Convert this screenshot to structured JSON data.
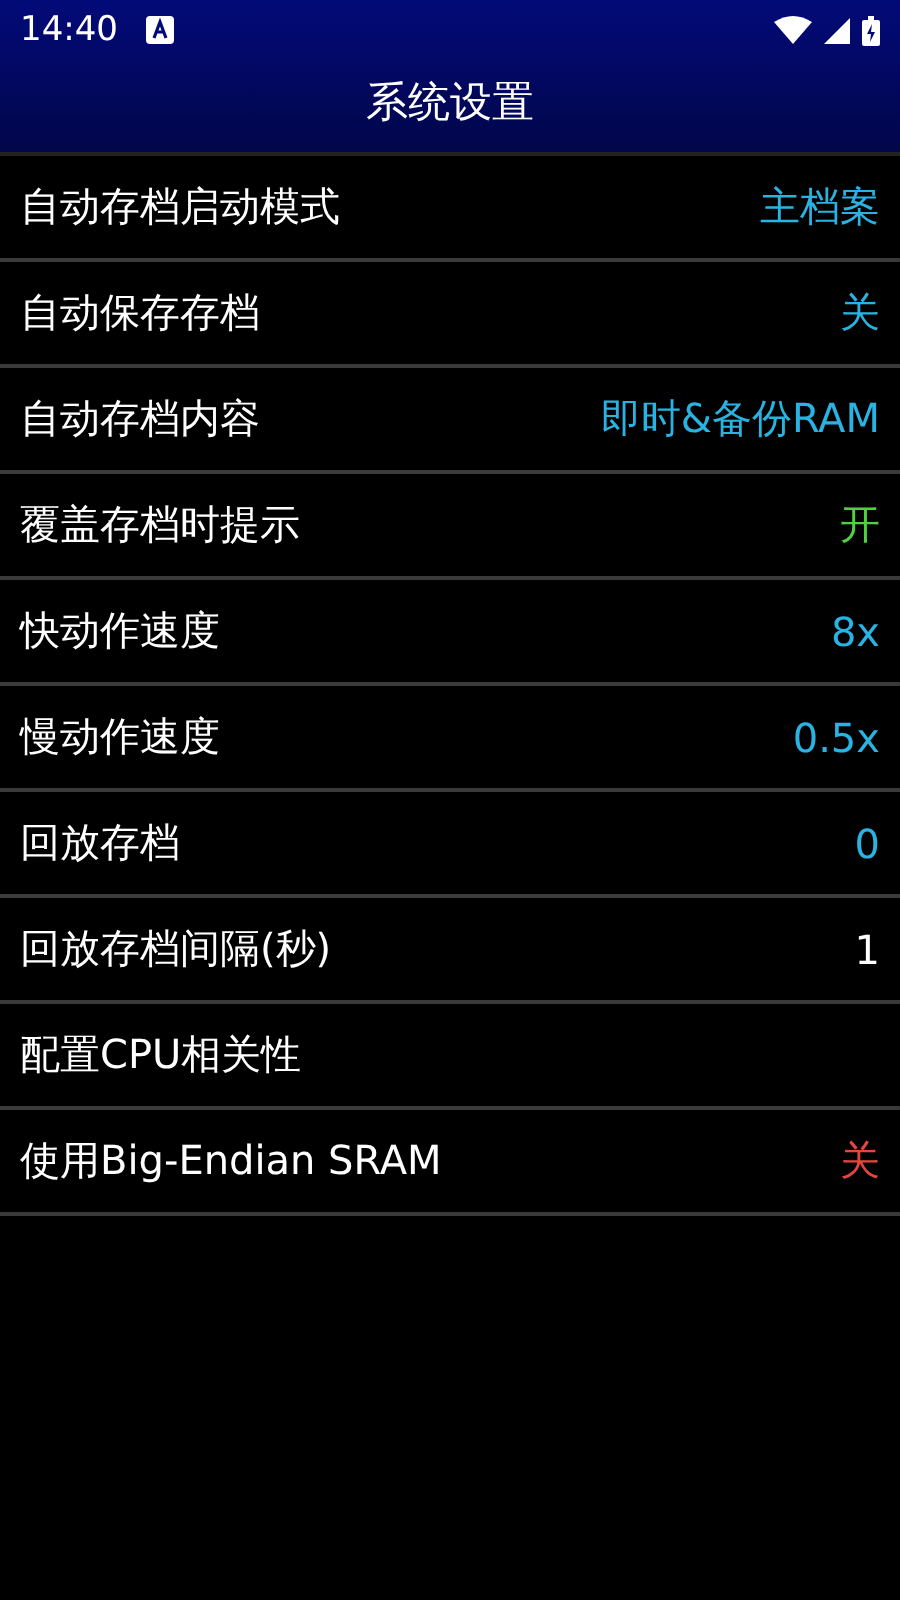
{
  "status_bar": {
    "time": "14:40"
  },
  "title": "系统设置",
  "settings": [
    {
      "label": "自动存档启动模式",
      "value": "主档案",
      "color": "#29b3e3"
    },
    {
      "label": "自动保存存档",
      "value": "关",
      "color": "#29b3e3"
    },
    {
      "label": "自动存档内容",
      "value": "即时&备份RAM",
      "color": "#29b3e3"
    },
    {
      "label": "覆盖存档时提示",
      "value": "开",
      "color": "#4ed23f"
    },
    {
      "label": "快动作速度",
      "value": "8x",
      "color": "#29b3e3"
    },
    {
      "label": "慢动作速度",
      "value": "0.5x",
      "color": "#29b3e3"
    },
    {
      "label": "回放存档",
      "value": "0",
      "color": "#29b3e3"
    },
    {
      "label": "回放存档间隔(秒)",
      "value": "1",
      "color": "#ffffff"
    },
    {
      "label": "配置CPU相关性"
    },
    {
      "label": "使用Big-Endian SRAM",
      "value": "关",
      "color": "#e5463f"
    }
  ]
}
